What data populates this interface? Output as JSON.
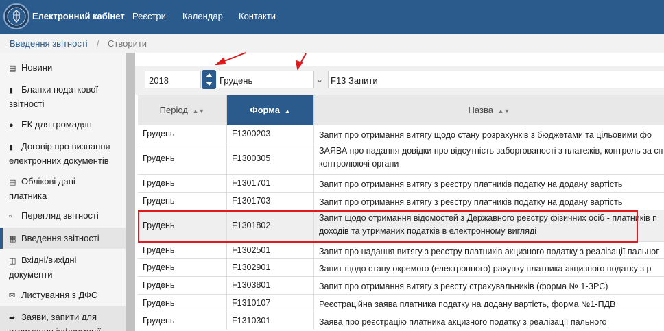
{
  "navbar": {
    "brand": "Електронний кабінет",
    "links": [
      "Реєстри",
      "Календар",
      "Контакти"
    ]
  },
  "breadcrumb": {
    "section": "Введення звітності",
    "separator": "/",
    "current": "Створити"
  },
  "sidebar": {
    "items": [
      {
        "label": "Новини",
        "icon": "newspaper-icon"
      },
      {
        "label": "Бланки податкової звітності",
        "icon": "document-icon"
      },
      {
        "label": "ЕК для громадян",
        "icon": "user-icon"
      },
      {
        "label": "Договір про визнання електронних документів",
        "icon": "document-icon"
      },
      {
        "label": "Облікові дані платника",
        "icon": "id-card-icon"
      },
      {
        "label": "Перегляд звітності",
        "icon": "file-icon"
      },
      {
        "label": "Введення звітності",
        "icon": "table-icon"
      },
      {
        "label": "Вхідні/вихідні документи",
        "icon": "inbox-icon"
      },
      {
        "label": "Листування з ДФС",
        "icon": "envelope-icon"
      },
      {
        "label": "Заяви, запити для отримання інформації",
        "icon": "share-icon"
      }
    ]
  },
  "filters": {
    "year": "2018",
    "month": "Грудень",
    "form_group": "F13 Запити"
  },
  "table": {
    "headers": {
      "period": "Період",
      "form": "Форма",
      "name": "Назва"
    },
    "rows": [
      {
        "period": "Грудень",
        "form": "F1300203",
        "name": "Запит про отримання витягу щодо стану розрахунків з бюджетами та цільовими фо"
      },
      {
        "period": "Грудень",
        "form": "F1300305",
        "name": "ЗАЯВА про надання довідки про відсутність заборгованості з платежів, контроль за сп контролюючі органи"
      },
      {
        "period": "Грудень",
        "form": "F1301701",
        "name": "Запит про отримання витягу з реєстру платників податку на додану вартість"
      },
      {
        "period": "Грудень",
        "form": "F1301703",
        "name": "Запит про отримання витягу з реєстру платників податку на додану вартість"
      },
      {
        "period": "Грудень",
        "form": "F1301802",
        "name": "Запит щодо отримання відомостей з Державного реєстру фізичних осіб - платників п доходів та утриманих податків в електронному вигляді"
      },
      {
        "period": "Грудень",
        "form": "F1302501",
        "name": "Запит про надання витягу з реєстру платників акцизного податку з реалізації пальног"
      },
      {
        "period": "Грудень",
        "form": "F1302901",
        "name": "Запит щодо стану окремого (електронного) рахунку платника акцизного податку з р"
      },
      {
        "period": "Грудень",
        "form": "F1303801",
        "name": "Запит про отримання витягу з реєсту страхувальників (форма № 1-ЗРС)"
      },
      {
        "period": "Грудень",
        "form": "F1310107",
        "name": "Реєстраційна заява платника податку на додану вартість, форма №1-ПДВ"
      },
      {
        "period": "Грудень",
        "form": "F1310301",
        "name": "Заява про реєстрацію платника акцизного податку з реалізації пального"
      }
    ]
  },
  "colors": {
    "navbar": "#2b5b8c",
    "sorted_header": "#2b5b8c",
    "annotation": "#e0191e"
  }
}
